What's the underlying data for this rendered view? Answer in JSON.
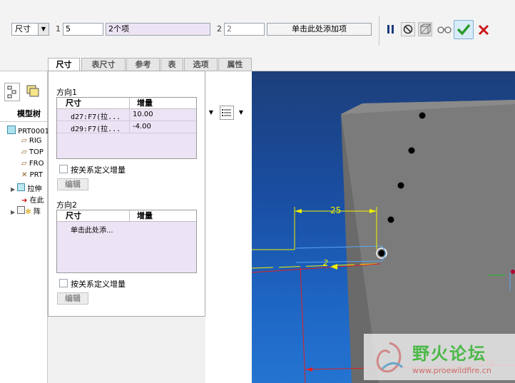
{
  "dashboard": {
    "type_select": "尺寸",
    "dir1_num": "1",
    "dir1_count": "5",
    "dir1_items": "2个项",
    "dir2_num": "2",
    "dir2_count": "2",
    "dir2_add": "单击此处添加项"
  },
  "tabs": [
    "尺寸",
    "表尺寸",
    "参考",
    "表",
    "选项",
    "属性"
  ],
  "panel": {
    "dir1_title": "方向1",
    "dir2_title": "方向2",
    "col_dim": "尺寸",
    "col_inc": "增量",
    "dir1_rows": [
      {
        "dim": "d27:F7(拉...",
        "inc": "10.00"
      },
      {
        "dim": "d29:F7(拉...",
        "inc": "-4.00"
      }
    ],
    "dir2_placeholder": "单击此处添...",
    "relation_label": "按关系定义增量",
    "edit_label": "编辑"
  },
  "tree": {
    "title": "模型树",
    "items": [
      "PRT0001",
      "RIG",
      "TOP",
      "FRO",
      "PRT",
      "拉伸",
      "在此",
      "阵"
    ]
  },
  "viewport": {
    "dim_value": "25",
    "dim_small": "2",
    "dim_bottom": "110"
  },
  "watermark": {
    "text": "野火论坛",
    "url": "www.proewildfire.cn"
  },
  "colors": {
    "accept": "#2b9a2b",
    "cancel": "#c81818",
    "viewport_blue": "#1e5fb8",
    "part_gray": "#7b7b7b",
    "dim_yellow": "#f0f000",
    "dim_red": "#e02020"
  }
}
